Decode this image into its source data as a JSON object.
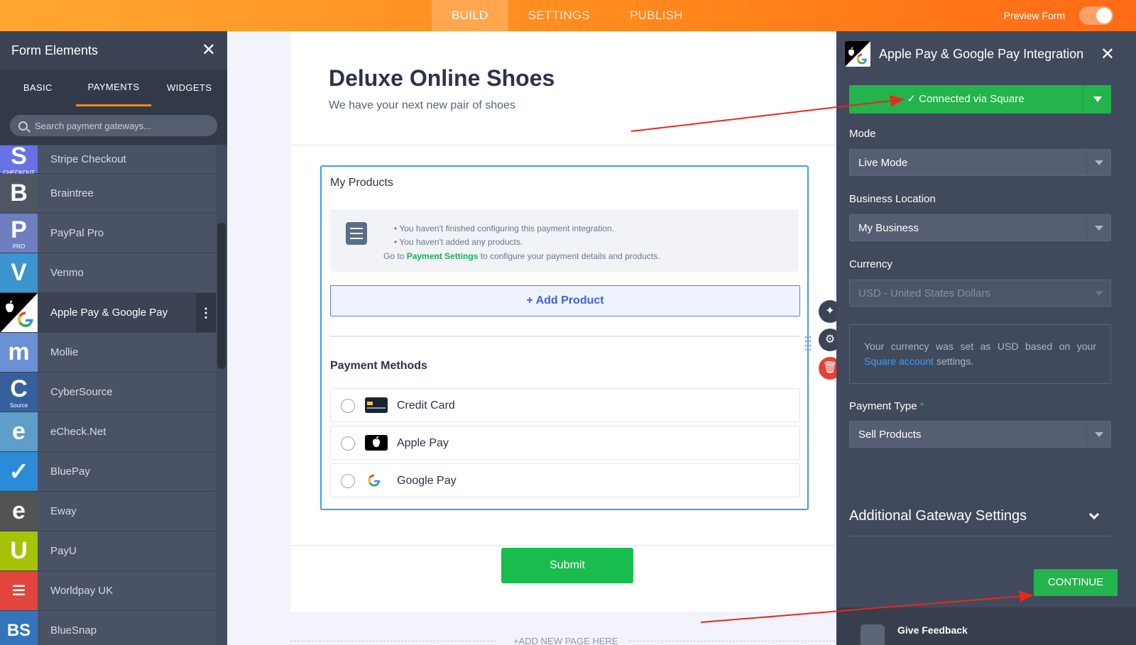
{
  "topbar": {
    "tabs": [
      {
        "label": "BUILD",
        "active": true
      },
      {
        "label": "SETTINGS",
        "active": false
      },
      {
        "label": "PUBLISH",
        "active": false
      }
    ],
    "preview_label": "Preview Form",
    "preview_on": false
  },
  "left_panel": {
    "title": "Form Elements",
    "tabs": [
      {
        "label": "BASIC",
        "active": false
      },
      {
        "label": "PAYMENTS",
        "active": true
      },
      {
        "label": "WIDGETS",
        "active": false
      }
    ],
    "search_placeholder": "Search payment gateways...",
    "gateways": [
      {
        "label": "Stripe Checkout",
        "icon": "stripe-icon",
        "color": "#6772e5",
        "glyph": "S",
        "sub": "CHECKOUT"
      },
      {
        "label": "Braintree",
        "icon": "braintree-icon",
        "color": "#4f5663",
        "glyph": "B",
        "sub": ""
      },
      {
        "label": "PayPal Pro",
        "icon": "paypal-icon",
        "color": "#6e7ec0",
        "glyph": "P",
        "sub": "PRO"
      },
      {
        "label": "Venmo",
        "icon": "venmo-icon",
        "color": "#3d95ce",
        "glyph": "V",
        "sub": ""
      },
      {
        "label": "Apple Pay & Google Pay",
        "icon": "apple-google-pay-icon",
        "color": "#ffffff",
        "glyph": "",
        "sub": "",
        "active": true
      },
      {
        "label": "Mollie",
        "icon": "mollie-icon",
        "color": "#6a8fd4",
        "glyph": "m",
        "sub": ""
      },
      {
        "label": "CyberSource",
        "icon": "cybersource-icon",
        "color": "#36609b",
        "glyph": "C",
        "sub": "Source"
      },
      {
        "label": "eCheck.Net",
        "icon": "echeck-icon",
        "color": "#5f9ec9",
        "glyph": "e",
        "sub": ""
      },
      {
        "label": "BluePay",
        "icon": "bluepay-icon",
        "color": "#2c8bd6",
        "glyph": "✓",
        "sub": ""
      },
      {
        "label": "Eway",
        "icon": "eway-icon",
        "color": "#535353",
        "glyph": "e",
        "sub": ""
      },
      {
        "label": "PayU",
        "icon": "payu-icon",
        "color": "#a6c307",
        "glyph": "U",
        "sub": ""
      },
      {
        "label": "Worldpay UK",
        "icon": "worldpay-icon",
        "color": "#e2453b",
        "glyph": "≡",
        "sub": ""
      },
      {
        "label": "BlueSnap",
        "icon": "bluesnap-icon",
        "color": "#3474bb",
        "glyph": "BS",
        "sub": ""
      }
    ]
  },
  "form": {
    "title": "Deluxe Online Shoes",
    "subtitle": "We have your next new pair of shoes",
    "products_label": "My Products",
    "notice_items": [
      "You haven't finished configuring this payment integration.",
      "You haven't added any products."
    ],
    "notice_prefix": "Go to ",
    "notice_link": "Payment Settings",
    "notice_suffix": " to configure your payment details and products.",
    "add_product_label": "+ Add Product",
    "payment_methods_label": "Payment Methods",
    "payment_methods": [
      {
        "label": "Credit Card",
        "icon": "credit-card-icon"
      },
      {
        "label": "Apple Pay",
        "icon": "apple-pay-icon"
      },
      {
        "label": "Google Pay",
        "icon": "google-pay-icon"
      }
    ],
    "submit_label": "Submit",
    "add_page_label": "+ADD NEW PAGE HERE"
  },
  "right_panel": {
    "title": "Apple Pay & Google Pay Integration",
    "connected_label": "✓ Connected via Square",
    "mode_label": "Mode",
    "mode_value": "Live Mode",
    "location_label": "Business Location",
    "location_value": "My Business",
    "currency_label": "Currency",
    "currency_value": "USD - United States Dollars",
    "currency_note_prefix": "Your currency was set as USD based on your ",
    "currency_note_link": "Square account",
    "currency_note_suffix": " settings.",
    "payment_type_label": "Payment Type",
    "payment_type_required": "*",
    "payment_type_value": "Sell Products",
    "additional_settings_label": "Additional Gateway Settings",
    "continue_label": "CONTINUE",
    "feedback_label": "Give Feedback"
  },
  "colors": {
    "accent_orange": "#ff8a1e",
    "success_green": "#24b34c",
    "annotation_red": "#e8271f"
  }
}
